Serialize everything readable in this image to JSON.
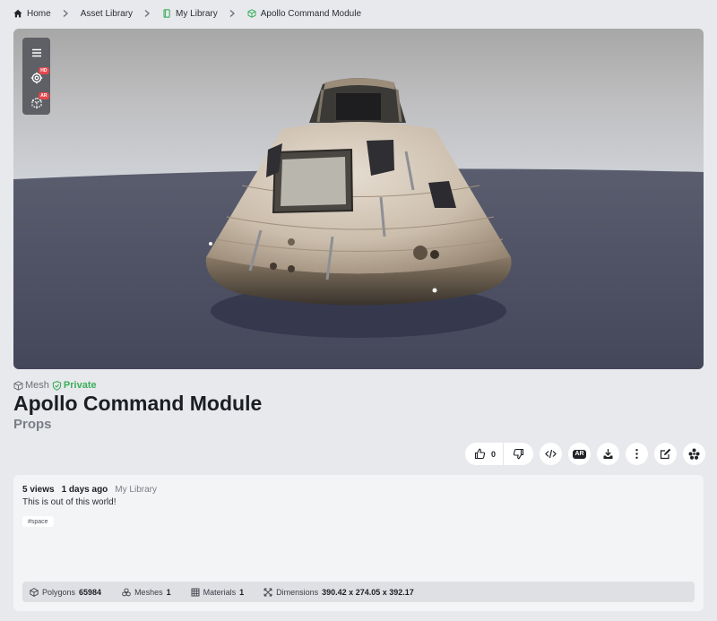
{
  "breadcrumb": {
    "home": "Home",
    "asset_library": "Asset Library",
    "my_library": "My Library",
    "current": "Apollo Command Module"
  },
  "viewer": {
    "tools": [
      {
        "icon": "menu-icon",
        "badge": ""
      },
      {
        "icon": "settings-icon",
        "badge": "HD"
      },
      {
        "icon": "ar-cube-icon",
        "badge": "AR"
      }
    ]
  },
  "asset": {
    "kind": "Mesh",
    "privacy": "Private",
    "title": "Apollo Command Module",
    "category": "Props"
  },
  "actions": {
    "likes": "0",
    "ar_label": "AR"
  },
  "info": {
    "views": "5 views",
    "age": "1 days ago",
    "library": "My Library",
    "description": "This is out of this world!",
    "tag": "#space"
  },
  "specs": {
    "polygons_label": "Polygons",
    "polygons": "65984",
    "meshes_label": "Meshes",
    "meshes": "1",
    "materials_label": "Materials",
    "materials": "1",
    "dimensions_label": "Dimensions",
    "dimensions": "390.42 x 274.05 x 392.17"
  },
  "colors": {
    "accent_green": "#3cae5b",
    "badge_red": "#e5484d",
    "floor": "#4b4e60"
  }
}
